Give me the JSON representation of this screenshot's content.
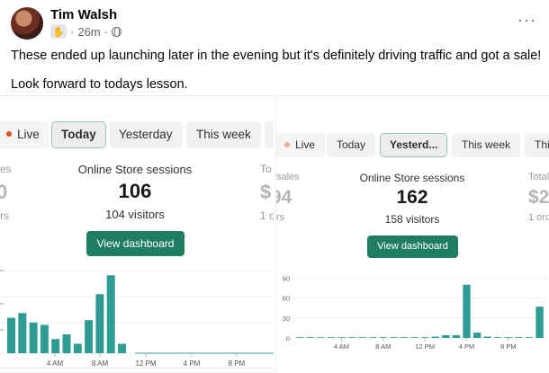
{
  "post": {
    "author": "Tim Walsh",
    "time": "26m",
    "more_label": "···",
    "text_line1": "These ended up launching later in the evening but it's definitely driving traffic and got a sale!",
    "text_line2": "Look forward to todays lesson."
  },
  "left_panel": {
    "tabs": [
      {
        "label": "Live",
        "active": false,
        "live_dot": "#e0511f"
      },
      {
        "label": "Today",
        "active": true
      },
      {
        "label": "Yesterday",
        "active": false
      },
      {
        "label": "This week",
        "active": false
      }
    ],
    "side_left_top": "es",
    "side_left_big": "0",
    "side_left_bottom": "rs",
    "side_right_top": "To",
    "side_right_big": "$",
    "side_right_bottom": "1 o",
    "stat_title": "Online Store sessions",
    "stat_value": "106",
    "stat_sub": "104 visitors",
    "button_label": "View dashboard",
    "x_tick_labels": [
      "4 AM",
      "8 AM",
      "12 PM",
      "4 PM",
      "8 PM"
    ]
  },
  "right_panel": {
    "tabs": [
      {
        "label": "Live",
        "active": false,
        "live_dot": "#f0a99a"
      },
      {
        "label": "Today",
        "active": false
      },
      {
        "label": "Yesterd...",
        "active": true
      },
      {
        "label": "This week",
        "active": false
      },
      {
        "label": "This",
        "active": false
      }
    ],
    "side_left_top": "sales",
    "side_left_big": "94",
    "side_left_bottom": "rs",
    "side_right_top": "Total",
    "side_right_big": "$2",
    "side_right_bottom": "1 ord",
    "stat_title": "Online Store sessions",
    "stat_value": "162",
    "stat_sub": "158 visitors",
    "button_label": "View dashboard",
    "y_tick_labels": [
      "90",
      "60",
      "30",
      "0"
    ],
    "x_tick_labels": [
      "4 AM",
      "8 AM",
      "12 PM",
      "4 PM",
      "8 PM"
    ]
  },
  "chart_data": [
    {
      "type": "bar",
      "x": [
        "12 AM",
        "1 AM",
        "2 AM",
        "3 AM",
        "4 AM",
        "5 AM",
        "6 AM",
        "7 AM",
        "8 AM",
        "9 AM",
        "10 AM",
        "11 AM",
        "12 PM",
        "1 PM",
        "2 PM",
        "3 PM",
        "4 PM",
        "5 PM",
        "6 PM",
        "7 PM",
        "8 PM",
        "9 PM",
        "10 PM",
        "11 PM"
      ],
      "values": [
        15,
        17,
        13,
        12,
        6,
        8,
        4,
        14,
        25,
        33,
        4,
        0,
        0,
        0,
        0,
        0,
        0,
        0,
        0,
        0,
        0,
        0,
        0,
        0
      ],
      "xlabel": "",
      "ylabel": "",
      "color": "#2e9c93"
    },
    {
      "type": "bar",
      "x": [
        "12 AM",
        "1 AM",
        "2 AM",
        "3 AM",
        "4 AM",
        "5 AM",
        "6 AM",
        "7 AM",
        "8 AM",
        "9 AM",
        "10 AM",
        "11 AM",
        "12 PM",
        "1 PM",
        "2 PM",
        "3 PM",
        "4 PM",
        "5 PM",
        "6 PM",
        "7 PM",
        "8 PM",
        "9 PM",
        "10 PM",
        "11 PM"
      ],
      "values": [
        1,
        1,
        1,
        1,
        1,
        1,
        1,
        1,
        1,
        1,
        1,
        1,
        1,
        2,
        4,
        4,
        80,
        8,
        2,
        1,
        1,
        1,
        1,
        47
      ],
      "ylim": [
        0,
        100
      ],
      "yticks": [
        0,
        30,
        60,
        90
      ],
      "xlabel": "",
      "ylabel": "",
      "color": "#2e9c93"
    }
  ]
}
